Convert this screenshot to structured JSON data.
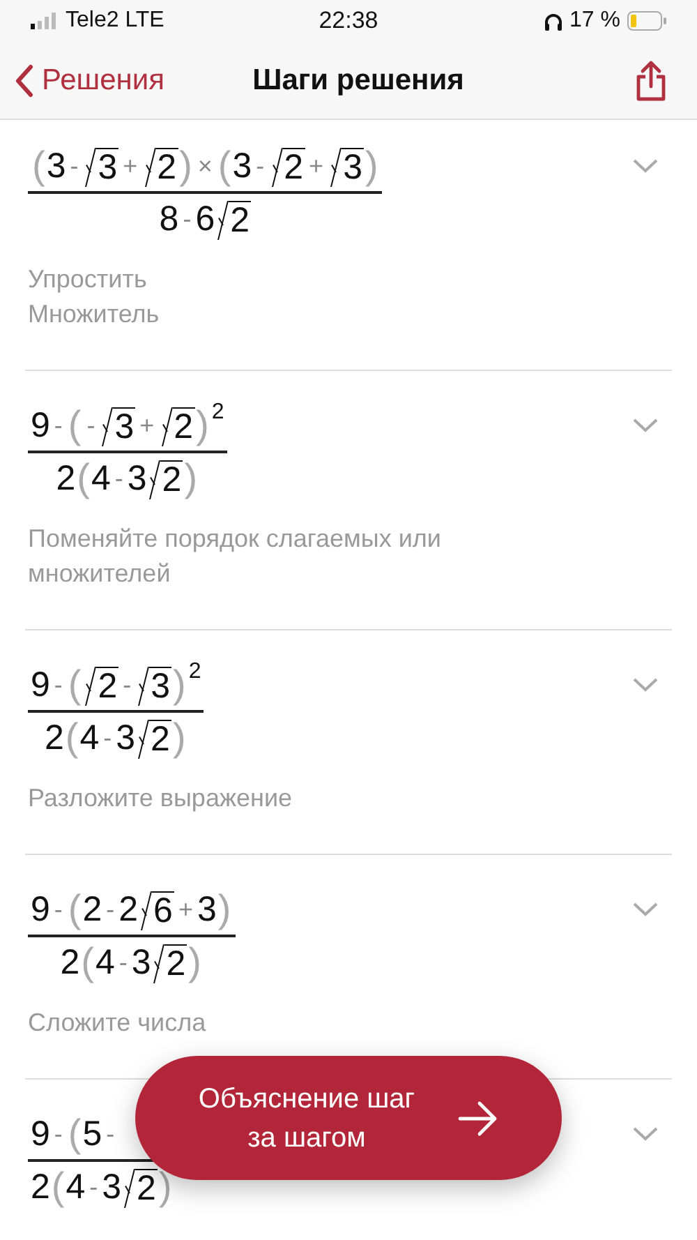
{
  "status_bar": {
    "carrier": "Tele2 LTE",
    "time": "22:38",
    "battery": "17 %"
  },
  "nav": {
    "back": "Решения",
    "title": "Шаги решения"
  },
  "steps": [
    {
      "numerator": [
        {
          "kind": "paren",
          "text": "("
        },
        {
          "kind": "num",
          "text": "3"
        },
        {
          "kind": "op",
          "text": "-"
        },
        {
          "kind": "sqrt",
          "text": "3"
        },
        {
          "kind": "op",
          "text": "+"
        },
        {
          "kind": "sqrt",
          "text": "2"
        },
        {
          "kind": "paren",
          "text": ")"
        },
        {
          "kind": "op",
          "text": "×"
        },
        {
          "kind": "paren",
          "text": "("
        },
        {
          "kind": "num",
          "text": "3"
        },
        {
          "kind": "op",
          "text": "-"
        },
        {
          "kind": "sqrt",
          "text": "2"
        },
        {
          "kind": "op",
          "text": "+"
        },
        {
          "kind": "sqrt",
          "text": "3"
        },
        {
          "kind": "paren",
          "text": ")"
        }
      ],
      "denominator": [
        {
          "kind": "num",
          "text": "8"
        },
        {
          "kind": "op",
          "text": "-"
        },
        {
          "kind": "num",
          "text": "6"
        },
        {
          "kind": "sqrt",
          "text": "2"
        }
      ],
      "description": "Упростить\nМножитель"
    },
    {
      "numerator": [
        {
          "kind": "num",
          "text": "9"
        },
        {
          "kind": "op",
          "text": "-"
        },
        {
          "kind": "paren",
          "text": "("
        },
        {
          "kind": "op",
          "text": "-"
        },
        {
          "kind": "sqrt",
          "text": "3"
        },
        {
          "kind": "op",
          "text": "+"
        },
        {
          "kind": "sqrt",
          "text": "2"
        },
        {
          "kind": "paren",
          "text": ")"
        },
        {
          "kind": "sup",
          "text": "2"
        }
      ],
      "denominator": [
        {
          "kind": "num",
          "text": "2"
        },
        {
          "kind": "paren",
          "text": "("
        },
        {
          "kind": "num",
          "text": "4"
        },
        {
          "kind": "op",
          "text": "-"
        },
        {
          "kind": "num",
          "text": "3"
        },
        {
          "kind": "sqrt",
          "text": "2"
        },
        {
          "kind": "paren",
          "text": ")"
        }
      ],
      "description": "Поменяйте порядок слагаемых или\nмножителей"
    },
    {
      "numerator": [
        {
          "kind": "num",
          "text": "9"
        },
        {
          "kind": "op",
          "text": "-"
        },
        {
          "kind": "paren",
          "text": "("
        },
        {
          "kind": "sqrt",
          "text": "2"
        },
        {
          "kind": "op",
          "text": "-"
        },
        {
          "kind": "sqrt",
          "text": "3"
        },
        {
          "kind": "paren",
          "text": ")"
        },
        {
          "kind": "sup",
          "text": "2"
        }
      ],
      "denominator": [
        {
          "kind": "num",
          "text": "2"
        },
        {
          "kind": "paren",
          "text": "("
        },
        {
          "kind": "num",
          "text": "4"
        },
        {
          "kind": "op",
          "text": "-"
        },
        {
          "kind": "num",
          "text": "3"
        },
        {
          "kind": "sqrt",
          "text": "2"
        },
        {
          "kind": "paren",
          "text": ")"
        }
      ],
      "description": "Разложите выражение"
    },
    {
      "numerator": [
        {
          "kind": "num",
          "text": "9"
        },
        {
          "kind": "op",
          "text": "-"
        },
        {
          "kind": "paren",
          "text": "("
        },
        {
          "kind": "num",
          "text": "2"
        },
        {
          "kind": "op",
          "text": "-"
        },
        {
          "kind": "num",
          "text": "2"
        },
        {
          "kind": "sqrt",
          "text": "6"
        },
        {
          "kind": "op",
          "text": "+"
        },
        {
          "kind": "num",
          "text": "3"
        },
        {
          "kind": "paren",
          "text": ")"
        }
      ],
      "denominator": [
        {
          "kind": "num",
          "text": "2"
        },
        {
          "kind": "paren",
          "text": "("
        },
        {
          "kind": "num",
          "text": "4"
        },
        {
          "kind": "op",
          "text": "-"
        },
        {
          "kind": "num",
          "text": "3"
        },
        {
          "kind": "sqrt",
          "text": "2"
        },
        {
          "kind": "paren",
          "text": ")"
        }
      ],
      "description": "Сложите числа"
    },
    {
      "numerator": [
        {
          "kind": "num",
          "text": "9"
        },
        {
          "kind": "op",
          "text": "-"
        },
        {
          "kind": "paren",
          "text": "("
        },
        {
          "kind": "num",
          "text": "5"
        },
        {
          "kind": "op",
          "text": "-"
        }
      ],
      "denominator": [
        {
          "kind": "num",
          "text": "2"
        },
        {
          "kind": "paren",
          "text": "("
        },
        {
          "kind": "num",
          "text": "4"
        },
        {
          "kind": "op",
          "text": "-"
        },
        {
          "kind": "num",
          "text": "3"
        },
        {
          "kind": "sqrt",
          "text": "2"
        },
        {
          "kind": "paren",
          "text": ")"
        }
      ]
    }
  ],
  "action_button": {
    "label": "Объяснение шаг\nза шагом"
  }
}
